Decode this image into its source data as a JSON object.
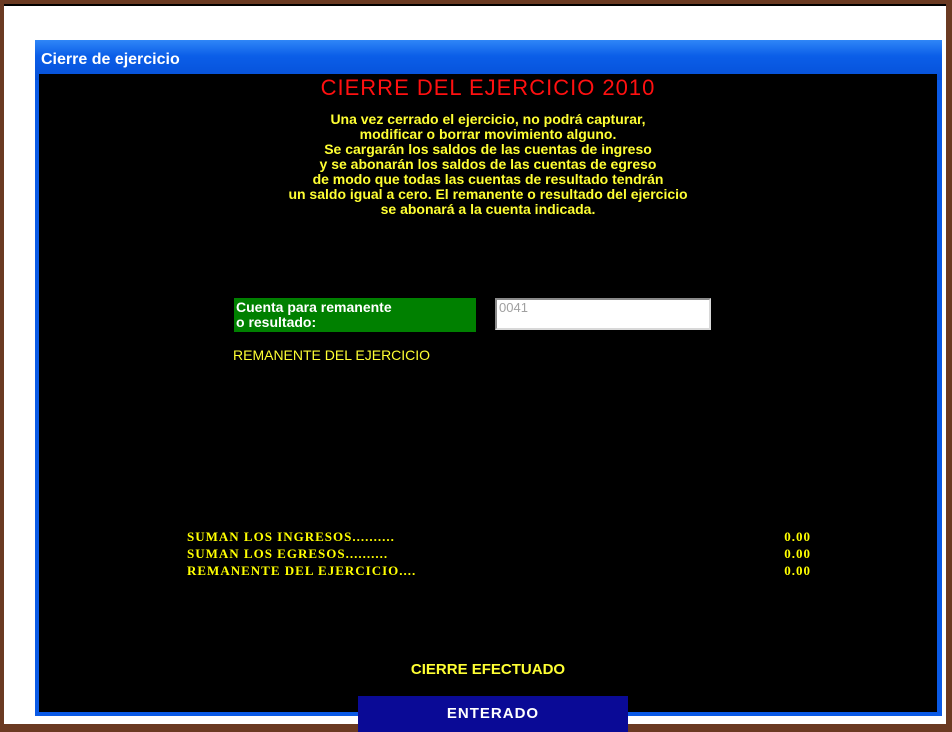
{
  "window": {
    "title": "Cierre de ejercicio"
  },
  "dialog": {
    "heading": "CIERRE DEL EJERCICIO 2010",
    "warning_lines": [
      "Una vez cerrado el ejercicio, no podrá capturar,",
      "modificar o borrar movimiento alguno.",
      "Se cargarán los saldos de las cuentas de ingreso",
      "y se abonarán los saldos de las cuentas de egreso",
      "de modo que todas las cuentas de resultado tendrán",
      "un saldo igual a cero. El remanente o resultado del ejercicio",
      "se abonará a la cuenta indicada."
    ],
    "account_label_lines": [
      "Cuenta para remanente",
      "o resultado:"
    ],
    "account_value": "0041",
    "remnant_label": "REMANENTE DEL EJERCICIO",
    "summary": [
      {
        "label": "SUMAN LOS INGRESOS..........",
        "value": "0.00"
      },
      {
        "label": "SUMAN LOS EGRESOS..........",
        "value": "0.00"
      },
      {
        "label": "REMANENTE DEL EJERCICIO....",
        "value": "0.00"
      }
    ],
    "status": "CIERRE EFECTUADO",
    "ok_button_label": "ENTERADO"
  },
  "colors": {
    "heading": "#ff1010",
    "text_yellow": "#ffff33",
    "label_bg": "#008000",
    "button_bg": "#0a0a96",
    "client_bg": "#000000",
    "titlebar": "#0b5ee8",
    "outer_bg": "#6b3a22"
  }
}
